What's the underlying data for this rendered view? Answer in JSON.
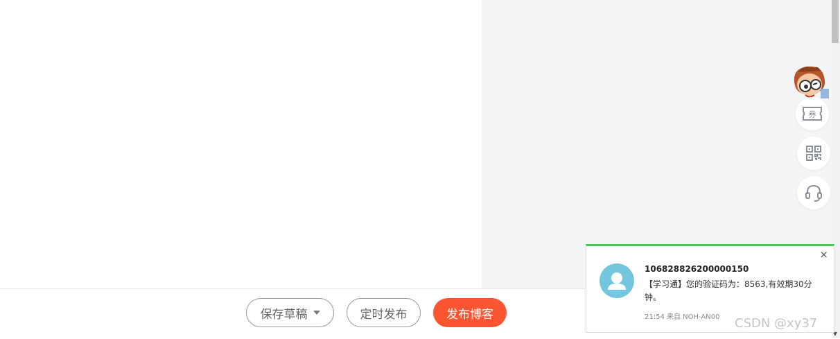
{
  "footer": {
    "save_draft_label": "保存草稿",
    "schedule_label": "定时发布",
    "publish_label": "发布博客"
  },
  "sidebar": {
    "coupon_icon": "coupon-icon",
    "coupon_text": "券",
    "qr_icon": "qr-code-icon",
    "service_icon": "headset-icon"
  },
  "notification": {
    "sender": "106828826200000150",
    "body": "【学习通】您的验证码为：8563,有效期30分钟。",
    "meta": "21:54 来自 NOH-AN00",
    "close_label": "×"
  },
  "watermark": "CSDN @xy37",
  "colors": {
    "publish": "#fc5531",
    "notification_accent": "#4cc45a",
    "avatar": "#74c6de",
    "panel_bg": "#f4f5f7"
  }
}
